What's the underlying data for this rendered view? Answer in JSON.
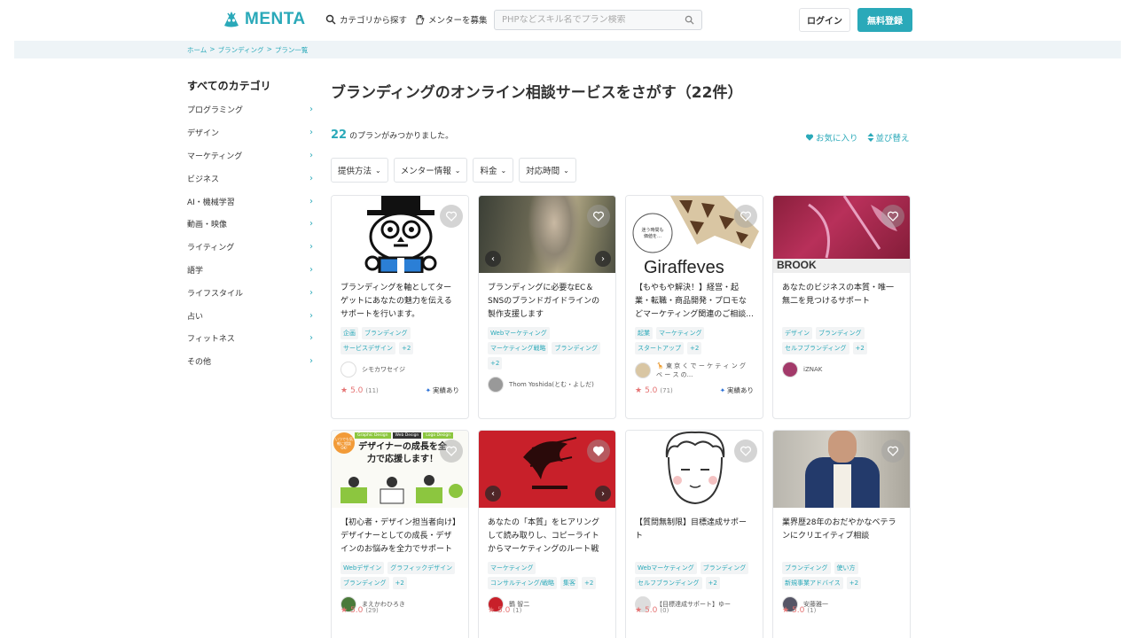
{
  "header": {
    "logo_text": "MENTA",
    "nav_category": "カテゴリから探す",
    "nav_recruit": "メンターを募集",
    "search_placeholder": "PHPなどスキル名でプラン検索",
    "login_label": "ログイン",
    "register_label": "無料登録",
    "brand_color": "#2aa9b9"
  },
  "breadcrumb": [
    "ホーム",
    "ブランディング",
    "プラン一覧"
  ],
  "breadcrumb_sep": ">",
  "sidebar": {
    "title": "すべてのカテゴリ",
    "items": [
      "プログラミング",
      "デザイン",
      "マーケティング",
      "ビジネス",
      "AI・機械学習",
      "動画・映像",
      "ライティング",
      "語学",
      "ライフスタイル",
      "占い",
      "フィットネス",
      "その他"
    ]
  },
  "main": {
    "title": "ブランディングのオンライン相談サービスをさがす（22件）",
    "result_count": "22",
    "result_text": "のプランがみつかりました。",
    "favorites_label": "お気に入り",
    "sort_label": "並び替え",
    "filters": [
      "提供方法",
      "メンター情報",
      "料金",
      "対応時間"
    ]
  },
  "cards": [
    {
      "title": "ブランディングを軸としてターゲットにあなたの魅力を伝えるサポートを行います。",
      "tags": [
        "企画",
        "ブランディング",
        "サービスデザイン",
        "+2"
      ],
      "mentor": "シモカワセイジ",
      "rating": "5.0",
      "count": "(11)",
      "badge": "実績あり"
    },
    {
      "title": "ブランディングに必要なEC＆SNSのブランドガイドラインの製作支援します",
      "tags": [
        "Webマーケティング",
        "マーケティング戦略",
        "ブランディング",
        "+2"
      ],
      "mentor": "Thom Yoshida(とむ・よしだ)",
      "rating": "",
      "count": "",
      "badge": ""
    },
    {
      "title": "【もやもや解決！】経営・起業・転職・商品開発・プロモなどマーケティング関連のご相談...",
      "tags": [
        "起業",
        "マーケティング",
        "スタートアップ",
        "+2"
      ],
      "mentor": "🦒 東 京 く で ー ケ テ ィ ン グ ベ ー ス の...",
      "rating": "5.0",
      "count": "(71)",
      "badge": "実績あり",
      "thumb_text": "Giraffeyes"
    },
    {
      "title": "あなたのビジネスの本質・唯一無二を見つけるサポート",
      "tags": [
        "デザイン",
        "ブランディング",
        "セルフブランディング",
        "+2"
      ],
      "mentor": "iZNAK",
      "rating": "",
      "count": "",
      "badge": "",
      "thumb_text": "BROOK"
    },
    {
      "title": "【初心者・デザイン担当者向け】デザイナーとしての成長・デザインのお悩みを全力でサポートし...",
      "tags": [
        "Webデザイン",
        "グラフィックデザイン",
        "ブランディング",
        "+2"
      ],
      "mentor": "まえかわひろき",
      "rating": "5.0",
      "count": "(29)",
      "badge": "",
      "thumb_text": "デザイナーの成長を全力で応援します！",
      "thumb_chips": [
        "Graphic Design",
        "Web Design",
        "Logo Design"
      ],
      "thumb_bubble": "いつでも気軽に相談OK!"
    },
    {
      "title": "あなたの「本質」をヒアリングして読み取りし、コピーライトからマーケティングのルート戦略ま...",
      "tags": [
        "マーケティング",
        "コンサルティング/戦略",
        "集客",
        "+2"
      ],
      "mentor": "鶴 智二",
      "rating": "5.0",
      "count": "(1)",
      "badge": ""
    },
    {
      "title": "【質問無制限】目標達成サポート",
      "tags": [
        "Webマーケティング",
        "ブランディング",
        "セルフブランディング",
        "+2"
      ],
      "mentor": "【目標達成サポート】ゆー",
      "rating": "5.0",
      "count": "(0)",
      "badge": ""
    },
    {
      "title": "業界歴28年のおだやかなベテランにクリエイティブ相談",
      "tags": [
        "ブランディング",
        "使い方",
        "新規事業アドバイス",
        "+2"
      ],
      "mentor": "安藤雅一",
      "rating": "5.0",
      "count": "(1)",
      "badge": ""
    }
  ],
  "colors": {
    "accent": "#2aa9b9",
    "rating": "#e57373",
    "crumb_bg": "#eef4f7"
  }
}
